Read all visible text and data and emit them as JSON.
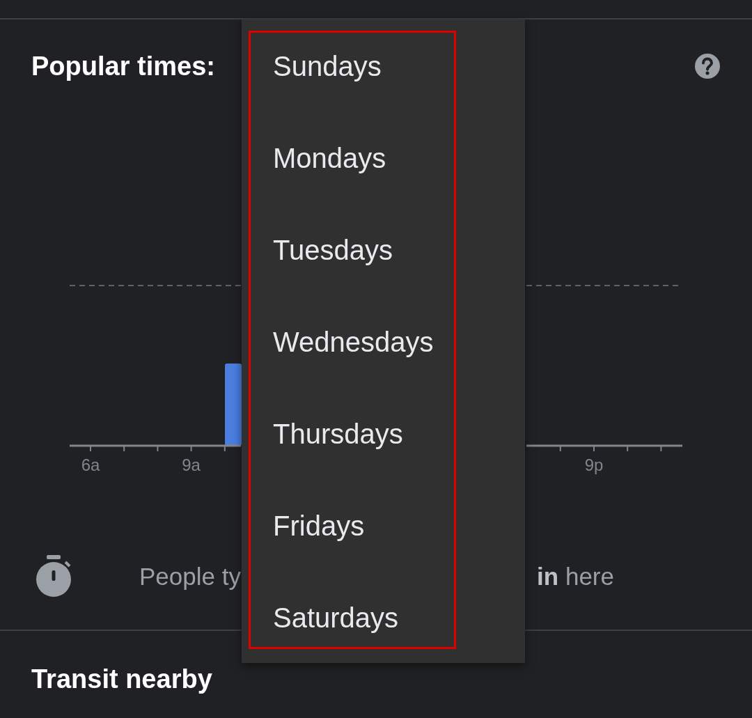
{
  "section": {
    "title": "Popular times:"
  },
  "chart": {
    "tick_labels": [
      {
        "label": "6a"
      },
      {
        "label": "9a"
      },
      {
        "label": "9p"
      }
    ]
  },
  "note": {
    "parts": [
      "People ty",
      "**in** here"
    ]
  },
  "day_menu": {
    "items": [
      {
        "label": "Sundays"
      },
      {
        "label": "Mondays"
      },
      {
        "label": "Tuesdays"
      },
      {
        "label": "Wednesdays"
      },
      {
        "label": "Thursdays"
      },
      {
        "label": "Fridays"
      },
      {
        "label": "Saturdays"
      }
    ]
  },
  "next_section": {
    "title": "Transit nearby"
  }
}
